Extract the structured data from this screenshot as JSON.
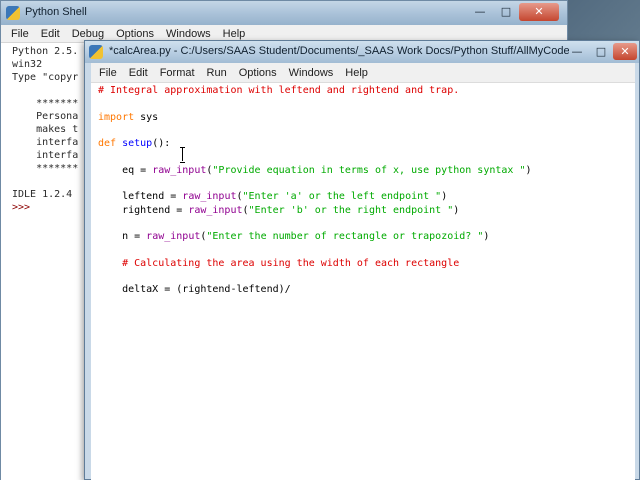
{
  "shell": {
    "title": "Python Shell",
    "controls": {
      "minimize": "—",
      "maximize": "□",
      "close": "✕"
    },
    "menu": [
      "File",
      "Edit",
      "Debug",
      "Options",
      "Windows",
      "Help"
    ],
    "output_lines": [
      "Python 2.5.",
      "win32",
      "Type \"copyr",
      "",
      "    *******",
      "    Persona",
      "    makes t",
      "    interfa",
      "    interfa",
      "    *******",
      "",
      "IDLE 1.2.4",
      ">>> "
    ]
  },
  "editor": {
    "title": "*calcArea.py - C:/Users/SAAS Student/Documents/_SAAS Work Docs/Python Stuff/AllMyCodes/Math ...",
    "controls": {
      "minimize": "—",
      "maximize": "□",
      "close": "✕"
    },
    "menu": [
      "File",
      "Edit",
      "Format",
      "Run",
      "Options",
      "Windows",
      "Help"
    ],
    "code_lines": [
      [
        {
          "t": "# Integral approximation with leftend and rightend and trap.",
          "c": "comment"
        }
      ],
      [],
      [
        {
          "t": "import",
          "c": "keyword"
        },
        {
          "t": " sys",
          "c": "plain"
        }
      ],
      [],
      [
        {
          "t": "def",
          "c": "keyword"
        },
        {
          "t": " ",
          "c": "plain"
        },
        {
          "t": "setup",
          "c": "def"
        },
        {
          "t": "():",
          "c": "plain"
        }
      ],
      [],
      [
        {
          "t": "    eq = ",
          "c": "plain"
        },
        {
          "t": "raw_input",
          "c": "builtin"
        },
        {
          "t": "(",
          "c": "plain"
        },
        {
          "t": "\"Provide equation in terms of x, use python syntax \"",
          "c": "string"
        },
        {
          "t": ")",
          "c": "plain"
        }
      ],
      [],
      [
        {
          "t": "    leftend = ",
          "c": "plain"
        },
        {
          "t": "raw_input",
          "c": "builtin"
        },
        {
          "t": "(",
          "c": "plain"
        },
        {
          "t": "\"Enter 'a' or the left endpoint \"",
          "c": "string"
        },
        {
          "t": ")",
          "c": "plain"
        }
      ],
      [
        {
          "t": "    rightend = ",
          "c": "plain"
        },
        {
          "t": "raw_input",
          "c": "builtin"
        },
        {
          "t": "(",
          "c": "plain"
        },
        {
          "t": "\"Enter 'b' or the right endpoint \"",
          "c": "string"
        },
        {
          "t": ")",
          "c": "plain"
        }
      ],
      [],
      [
        {
          "t": "    n = ",
          "c": "plain"
        },
        {
          "t": "raw_input",
          "c": "builtin"
        },
        {
          "t": "(",
          "c": "plain"
        },
        {
          "t": "\"Enter the number of rectangle or trapozoid? \"",
          "c": "string"
        },
        {
          "t": ")",
          "c": "plain"
        }
      ],
      [],
      [
        {
          "t": "    # Calculating the area using the width of each rectangle",
          "c": "comment"
        }
      ],
      [],
      [
        {
          "t": "    deltaX = (rightend-leftend)/",
          "c": "plain"
        }
      ]
    ]
  }
}
